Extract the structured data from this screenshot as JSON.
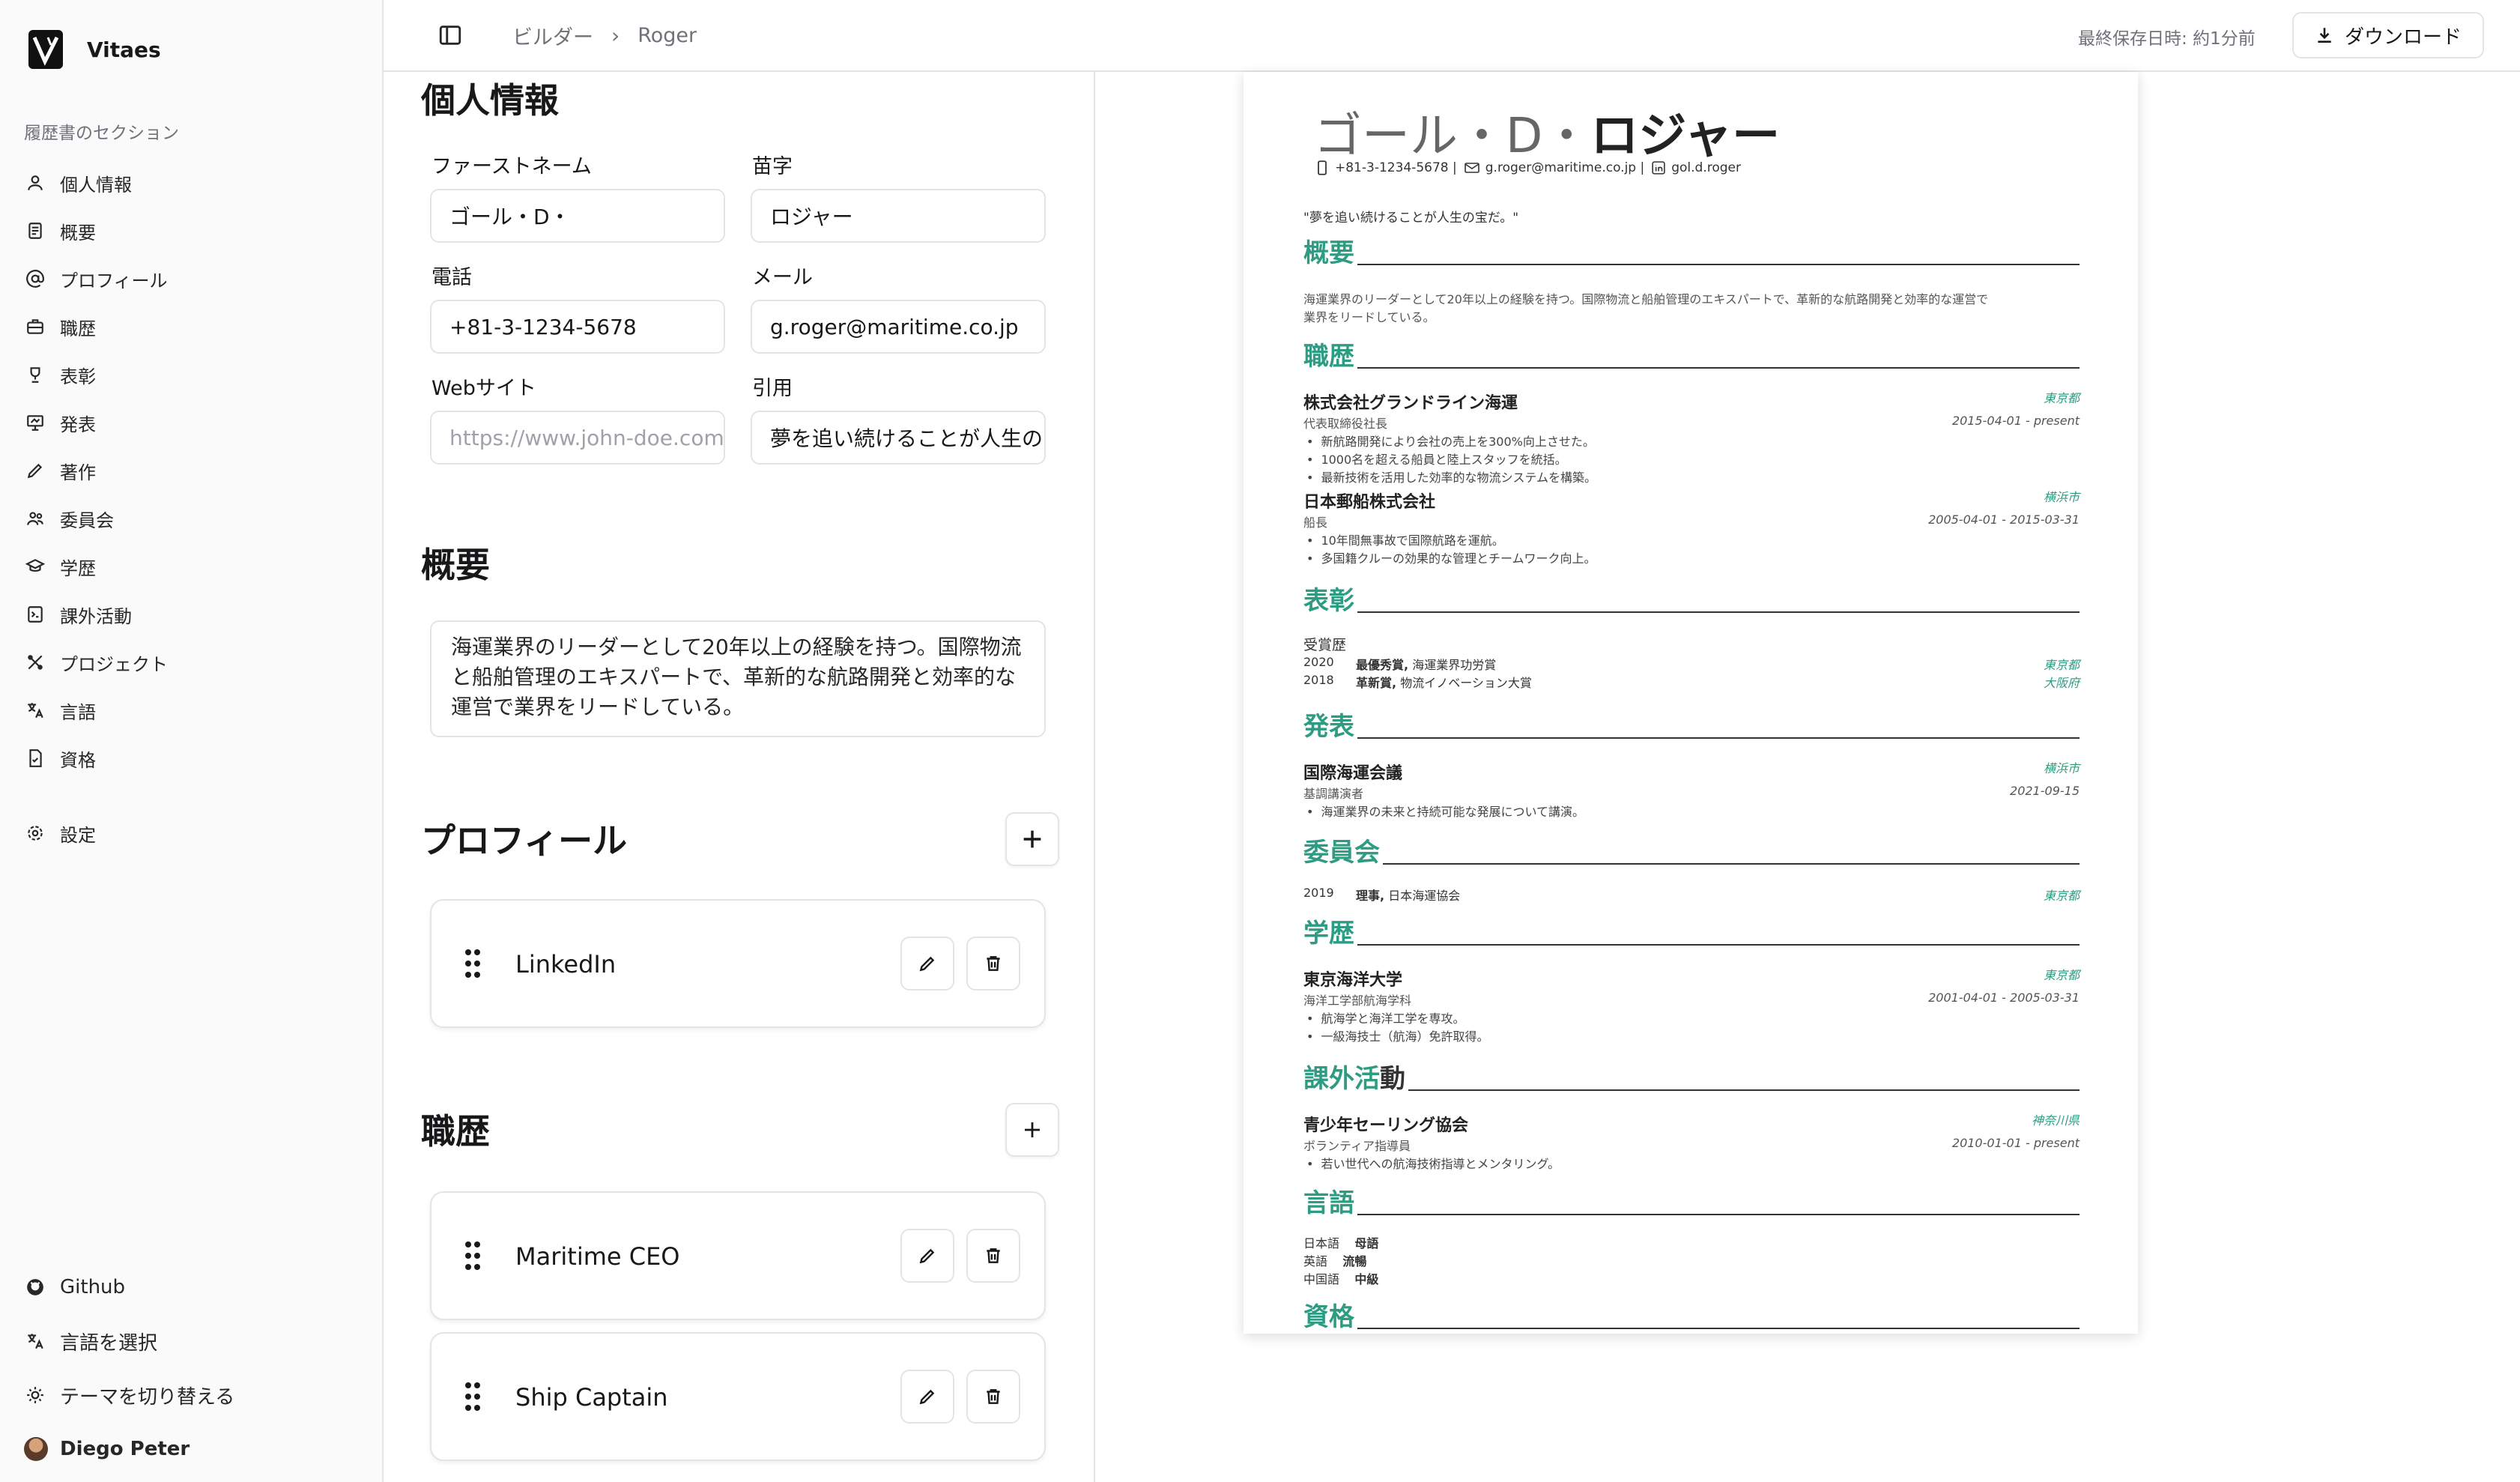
{
  "app": {
    "name": "Vitaes",
    "section_label": "履歴書のセクション",
    "nav": [
      {
        "label": "個人情報",
        "icon": "user-icon"
      },
      {
        "label": "概要",
        "icon": "document-icon"
      },
      {
        "label": "プロフィール",
        "icon": "at-sign-icon"
      },
      {
        "label": "職歴",
        "icon": "briefcase-icon"
      },
      {
        "label": "表彰",
        "icon": "trophy-icon"
      },
      {
        "label": "発表",
        "icon": "presentation-icon"
      },
      {
        "label": "著作",
        "icon": "pen-icon"
      },
      {
        "label": "委員会",
        "icon": "users-icon"
      },
      {
        "label": "学歴",
        "icon": "graduation-cap-icon"
      },
      {
        "label": "課外活動",
        "icon": "activity-icon"
      },
      {
        "label": "プロジェクト",
        "icon": "tools-icon"
      },
      {
        "label": "言語",
        "icon": "language-icon"
      },
      {
        "label": "資格",
        "icon": "certificate-icon"
      }
    ],
    "settings": "設定",
    "bottom": {
      "github": "Github",
      "language": "言語を選択",
      "theme": "テーマを切り替える",
      "user": "Diego Peter"
    }
  },
  "topbar": {
    "crumb_root": "ビルダー",
    "crumb_current": "Roger",
    "saved": "最終保存日時: 約1分前",
    "download": "ダウンロード"
  },
  "editor": {
    "personal": {
      "heading": "個人情報",
      "first_name_label": "ファーストネーム",
      "first_name": "ゴール・D・",
      "last_name_label": "苗字",
      "last_name": "ロジャー",
      "phone_label": "電話",
      "phone": "+81-3-1234-5678",
      "email_label": "メール",
      "email": "g.roger@maritime.co.jp",
      "website_label": "Webサイト",
      "website_placeholder": "https://www.john-doe.com",
      "quote_label": "引用",
      "quote": "夢を追い続けることが人生の"
    },
    "summary": {
      "heading": "概要",
      "text": "海運業界のリーダーとして20年以上の経験を持つ。国際物流と船舶管理のエキスパートで、革新的な航路開発と効率的な運営で業界をリードしている。"
    },
    "profiles": {
      "heading": "プロフィール",
      "items": [
        "LinkedIn"
      ]
    },
    "experience": {
      "heading": "職歴",
      "items": [
        "Maritime CEO",
        "Ship Captain"
      ]
    }
  },
  "preview": {
    "name_light": "ゴール・D・",
    "name_bold": "ロジャー",
    "phone": "+81-3-1234-5678",
    "email": "g.roger@maritime.co.jp",
    "linkedin": "gol.d.roger",
    "quote": "\"夢を追い続けることが人生の宝だ。\"",
    "sec_summary": "概要",
    "summary_l1": "海運業界のリーダーとして20年以上の経験を持つ。国際物流と船舶管理のエキスパートで、革新的な航路開発と効率的な運営で",
    "summary_l2": "業界をリードしている。",
    "sec_experience": "職歴",
    "job1_org": "株式会社グランドライン海運",
    "job1_loc": "東京都",
    "job1_role": "代表取締役社長",
    "job1_date": "2015-04-01 - present",
    "job1_b1": "新航路開発により会社の売上を300%向上させた。",
    "job1_b2": "1000名を超える船員と陸上スタッフを統括。",
    "job1_b3": "最新技術を活用した効率的な物流システムを構築。",
    "job2_org": "日本郵船株式会社",
    "job2_loc": "横浜市",
    "job2_role": "船長",
    "job2_date": "2005-04-01 - 2015-03-31",
    "job2_b1": "10年間無事故で国際航路を運航。",
    "job2_b2": "多国籍クルーの効果的な管理とチームワーク向上。",
    "sec_awards": "表彰",
    "awards_sub": "受賞歴",
    "award1_year": "2020",
    "award1_title": "最優秀賞,",
    "award1_org": "海運業界功労賞",
    "award1_loc": "東京都",
    "award2_year": "2018",
    "award2_title": "革新賞,",
    "award2_org": "物流イノベーション大賞",
    "award2_loc": "大阪府",
    "sec_talks": "発表",
    "talk_org": "国際海運会議",
    "talk_loc": "横浜市",
    "talk_role": "基調講演者",
    "talk_date": "2021-09-15",
    "talk_b1": "海運業界の未来と持続可能な発展について講演。",
    "sec_committee": "委員会",
    "comm_year": "2019",
    "comm_title": "理事,",
    "comm_org": "日本海運協会",
    "comm_loc": "東京都",
    "sec_education": "学歴",
    "edu_org": "東京海洋大学",
    "edu_loc": "東京都",
    "edu_role": "海洋工学部航海学科",
    "edu_date": "2001-04-01 - 2005-03-31",
    "edu_b1": "航海学と海洋工学を専攻。",
    "edu_b2": "一級海技士（航海）免許取得。",
    "sec_extra_a": "課外活",
    "sec_extra_b": "動",
    "extra_org": "青少年セーリング協会",
    "extra_loc": "神奈川県",
    "extra_role": "ボランティア指導員",
    "extra_date": "2010-01-01 - present",
    "extra_b1": "若い世代への航海技術指導とメンタリング。",
    "sec_languages": "言語",
    "lang1": "日本語",
    "lang1_level": "母語",
    "lang2": "英語",
    "lang2_level": "流暢",
    "lang3": "中国語",
    "lang3_level": "中級",
    "sec_certs": "資格"
  },
  "colors": {
    "accent": "#2d9c83",
    "border": "#e4e4e7",
    "muted": "#71717a"
  }
}
